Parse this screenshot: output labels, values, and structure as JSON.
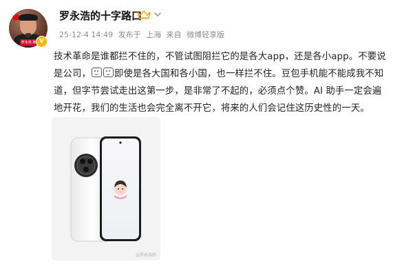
{
  "author": {
    "name": "罗永浩的十字路口",
    "avatar_badge_text": "罗永浩 推广 1 的",
    "verified_color": "#f7b500"
  },
  "meta": {
    "datetime": "25-12-4 14:49",
    "source_prefix": "发布于",
    "location": "上海",
    "via_prefix": "来自",
    "client": "微博轻享版"
  },
  "post": {
    "lines": [
      "技术革命是谁都拦不住的，不管试图阻拦它的是各大app，还是各小app。不要说",
      "即使是各大国和各小国，也一样拦不住。豆包手机能不能成我不知",
      "道，但字节尝试走出这第一步，是非常了不起的，必须点个赞。AI 助手一定会遍",
      "地开花，我们的生活也会完全离不开它，将来的人们会记住这历史性的一天。"
    ],
    "line2_prefix": "是公司，",
    "image_watermark": "@罗永浩的",
    "image_alt": "phone"
  },
  "colors": {
    "text": "#222222",
    "meta": "#8c8c8c",
    "crown": "#f5a623"
  },
  "icons": [
    "crown-icon",
    "chevron-down-icon",
    "verified-badge-icon",
    "emoji-icon"
  ]
}
